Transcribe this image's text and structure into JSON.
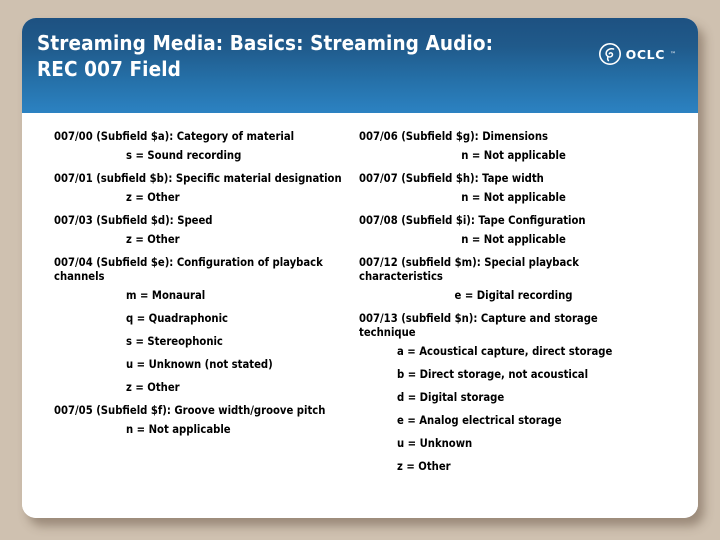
{
  "slide": {
    "title": "Streaming Media:  Basics:  Streaming Audio:\nREC 007 Field",
    "logo": {
      "mark": "oclc-circle-mark",
      "wordmark": "OCLC",
      "trademark": "™"
    },
    "colors": {
      "header_top": "#1d5181",
      "header_bottom": "#2c82c2",
      "page_background": "#cfc1b0",
      "slide_background": "#ffffff",
      "text": "#000000"
    },
    "left_column": [
      {
        "kind": "head",
        "text": "007/00 (Subfield $a):  Category of material"
      },
      {
        "kind": "value",
        "text": "s = Sound recording"
      },
      {
        "kind": "head",
        "text": "007/01 (subfield $b):  Specific material designation"
      },
      {
        "kind": "value",
        "text": "z = Other"
      },
      {
        "kind": "head",
        "text": "007/03 (Subfield $d):  Speed"
      },
      {
        "kind": "value",
        "text": "z = Other"
      },
      {
        "kind": "head",
        "text": "007/04 (Subfield $e): Configuration of playback channels"
      },
      {
        "kind": "value",
        "text": "m = Monaural"
      },
      {
        "kind": "value",
        "text": "q = Quadraphonic"
      },
      {
        "kind": "value",
        "text": "s = Stereophonic"
      },
      {
        "kind": "value",
        "text": "u = Unknown (not stated)"
      },
      {
        "kind": "value",
        "text": "z = Other"
      },
      {
        "kind": "head",
        "text": "007/05 (Subfield $f):  Groove width/groove pitch"
      },
      {
        "kind": "value",
        "text": "n = Not applicable"
      }
    ],
    "right_column": [
      {
        "kind": "head",
        "text": "007/06 (Subfield $g):  Dimensions"
      },
      {
        "kind": "value",
        "text": "n = Not applicable"
      },
      {
        "kind": "head",
        "text": "007/07 (Subfield $h):  Tape width"
      },
      {
        "kind": "value",
        "text": "n = Not applicable"
      },
      {
        "kind": "head",
        "text": "007/08 (Subfield $i):  Tape Configuration"
      },
      {
        "kind": "value",
        "text": "n = Not applicable"
      },
      {
        "kind": "head",
        "text": "007/12 (subfield $m):  Special playback characteristics"
      },
      {
        "kind": "value",
        "text": "e = Digital recording"
      },
      {
        "kind": "head",
        "text": "007/13 (subfield $n):  Capture and storage technique"
      },
      {
        "kind": "value",
        "list": true,
        "text": "a = Acoustical capture, direct storage"
      },
      {
        "kind": "value",
        "list": true,
        "text": "b = Direct storage, not acoustical"
      },
      {
        "kind": "value",
        "list": true,
        "text": "d = Digital storage"
      },
      {
        "kind": "value",
        "list": true,
        "text": "e = Analog electrical storage"
      },
      {
        "kind": "value",
        "list": true,
        "text": "u = Unknown"
      },
      {
        "kind": "value",
        "list": true,
        "text": "z = Other"
      }
    ]
  }
}
